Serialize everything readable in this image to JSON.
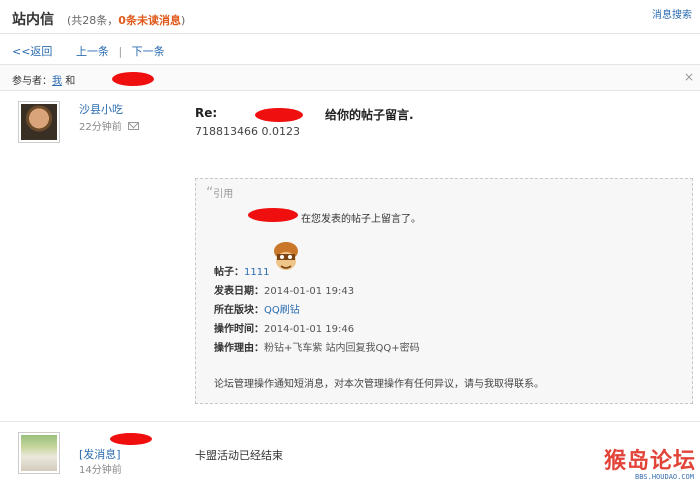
{
  "header": {
    "title": "站内信",
    "count_prefix": "(共28条，",
    "unread": "0条未读消息",
    "count_suffix": ")",
    "search_link": "消息搜索"
  },
  "nav": {
    "back": "<<返回",
    "prev": "上一条",
    "separator": "|",
    "next": "下一条"
  },
  "participants": {
    "label_prefix": "参与者：",
    "me": "我",
    "and": "和",
    "close": "×"
  },
  "message1": {
    "sender": "沙县小吃",
    "time": "22分钟前",
    "subject_prefix": "Re:",
    "subject_suffix": "给你的帖子留言.",
    "line": "718813466  0.0123",
    "quote": {
      "label": "引用",
      "intro": "在您发表的帖子上留言了。",
      "rows": [
        {
          "key": "帖子：",
          "value": "1111",
          "link": true
        },
        {
          "key": "发表日期：",
          "value": "2014-01-01 19:43",
          "link": false
        },
        {
          "key": "所在版块：",
          "value": "QQ刷钻",
          "link": true
        },
        {
          "key": "操作时间：",
          "value": "2014-01-01 19:46",
          "link": false
        },
        {
          "key": "操作理由：",
          "value": "粉钻+飞车紫  站内回复我QQ+密码",
          "link": false
        }
      ],
      "notice": "论坛管理操作通知短消息，对本次管理操作有任何异议，请与我取得联系。"
    }
  },
  "message2": {
    "sender": "[发消息]",
    "time": "14分钟前",
    "text": "卡盟活动已经结束"
  },
  "watermark": {
    "text": "猴岛论坛",
    "url": "BBS.HOUDAO.COM"
  },
  "colors": {
    "link": "#2b6cb0",
    "unread": "#e05a1c",
    "redaction": "#ef0f0f"
  }
}
